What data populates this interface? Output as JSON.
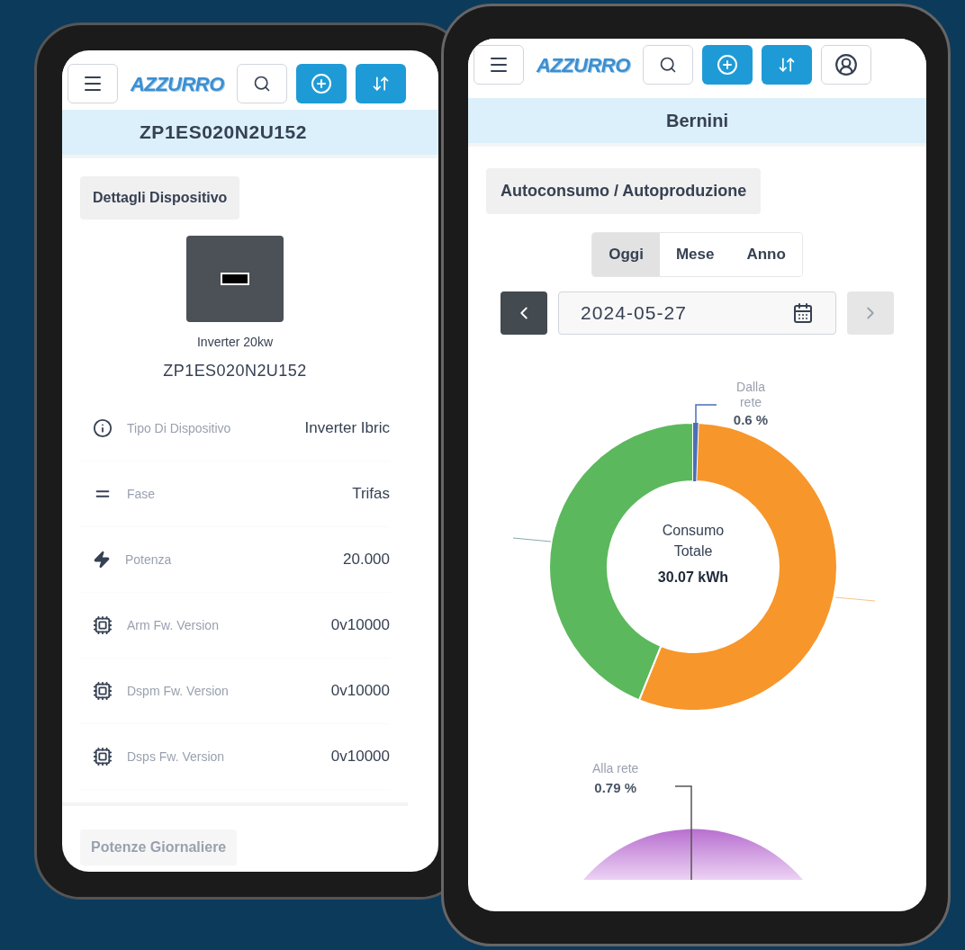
{
  "left_phone": {
    "logo": "AZZURRO",
    "title": "ZP1ES020N2U152",
    "section": "Dettagli Dispositivo",
    "device": {
      "name": "Inverter 20kw",
      "serial": "ZP1ES020N2U152"
    },
    "rows": [
      {
        "kind": "info",
        "label": "Tipo Di Dispositivo",
        "value": "Inverter Ibric"
      },
      {
        "kind": "phase",
        "label": "Fase",
        "value": "Trifas"
      },
      {
        "kind": "power",
        "label": "Potenza",
        "value": "20.000"
      },
      {
        "kind": "firmware",
        "label": "Arm Fw. Version",
        "value": "0v10000"
      },
      {
        "kind": "firmware",
        "label": "Dspm Fw. Version",
        "value": "0v10000"
      },
      {
        "kind": "firmware",
        "label": "Dsps Fw. Version",
        "value": "0v10000"
      }
    ],
    "next_section": "Potenze Giornaliere"
  },
  "right_phone": {
    "logo": "AZZURRO",
    "title": "Bernini",
    "section": "Autoconsumo / Autoproduzione",
    "periods": [
      {
        "label": "Oggi",
        "selected": true
      },
      {
        "label": "Mese",
        "selected": false
      },
      {
        "label": "Anno",
        "selected": false
      }
    ],
    "date": "2024-05-27",
    "donut": {
      "center_lines": [
        "Consumo",
        "Totale"
      ],
      "center_value": "30.07 kWh",
      "callout_label": "Dalla rete",
      "callout_value": "0.6 %"
    },
    "second_chart": {
      "callout_label": "Alla rete",
      "callout_value": "0.79 %"
    }
  }
}
